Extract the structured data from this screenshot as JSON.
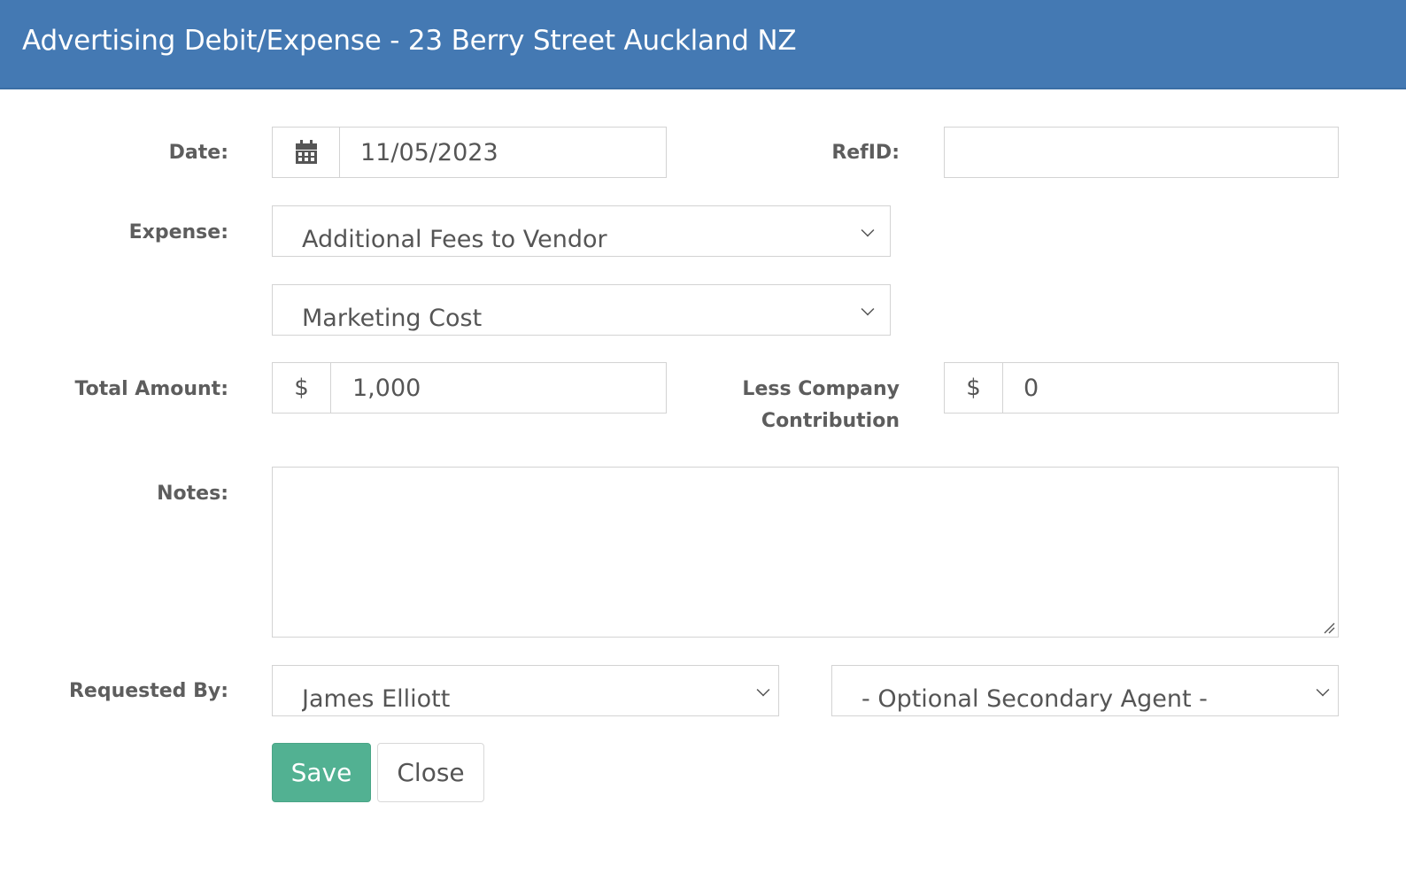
{
  "header": {
    "title": "Advertising Debit/Expense - 23 Berry Street Auckland NZ"
  },
  "form": {
    "date": {
      "label": "Date:",
      "value": "11/05/2023"
    },
    "refid": {
      "label": "RefID:",
      "value": ""
    },
    "expense": {
      "label": "Expense:",
      "primary_selected": "Additional Fees to Vendor",
      "secondary_selected": "Marketing Cost"
    },
    "total_amount": {
      "label": "Total Amount:",
      "currency": "$",
      "value": "1,000"
    },
    "company_contribution": {
      "label": "Less Company Contribution",
      "currency": "$",
      "value": "0"
    },
    "notes": {
      "label": "Notes:",
      "value": ""
    },
    "requested_by": {
      "label": "Requested By:",
      "agent_selected": "James Elliott",
      "secondary_agent_selected": "- Optional Secondary Agent -"
    }
  },
  "buttons": {
    "save_label": "Save",
    "close_label": "Close"
  },
  "icons": {
    "date_addon": "calendar-icon",
    "select_arrow": "chevron-down-icon"
  },
  "colors": {
    "header_background": "#4479b3",
    "save_button": "#52b192"
  }
}
